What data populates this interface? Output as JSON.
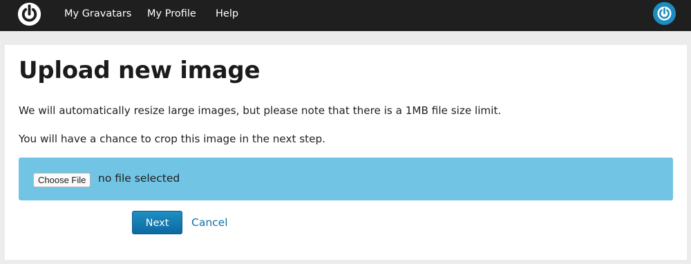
{
  "header": {
    "logo_icon": "gravatar-logo-icon",
    "nav": [
      {
        "label": "My Gravatars"
      },
      {
        "label": "My Profile"
      },
      {
        "label": "Help"
      }
    ],
    "avatar_icon": "user-avatar-icon",
    "colors": {
      "bar_background": "#1f1f1f",
      "avatar": "#1e8cbe"
    }
  },
  "main": {
    "title": "Upload new image",
    "description": "We will automatically resize large images, but please note that there is a 1MB file size limit.",
    "crop_note": "You will have a chance to crop this image in the next step.",
    "file_upload": {
      "button_label": "Choose File",
      "status": "no file selected",
      "background_color": "#72c4e4"
    },
    "actions": {
      "next_label": "Next",
      "cancel_label": "Cancel",
      "primary_color": "#137bb3",
      "link_color": "#0e6fa8"
    }
  }
}
